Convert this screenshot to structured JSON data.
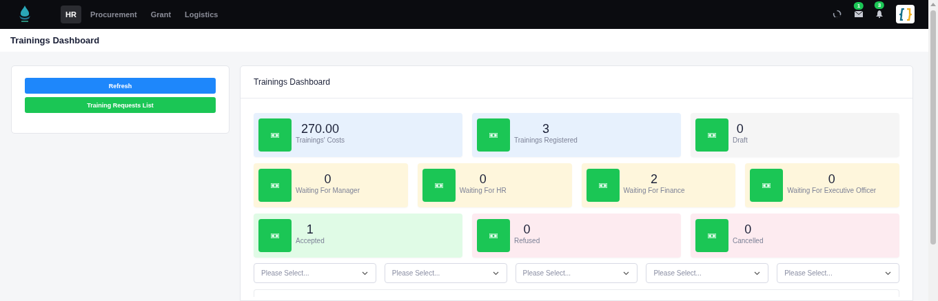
{
  "nav": {
    "tabs": [
      {
        "label": "HR",
        "selected": true
      },
      {
        "label": "Procurement",
        "selected": false
      },
      {
        "label": "Grant",
        "selected": false
      },
      {
        "label": "Logistics",
        "selected": false
      }
    ],
    "mail_badge": "1",
    "notification_badge": "3"
  },
  "page_title": "Trainings Dashboard",
  "side_panel": {
    "buttons": [
      {
        "label": "Refresh",
        "kind": "primary"
      },
      {
        "label": "Training Requests List",
        "kind": "success"
      }
    ]
  },
  "dashboard": {
    "title": "Trainings Dashboard",
    "stat_rows": [
      [
        {
          "value": "270.00",
          "label": "Trainings' Costs",
          "color": "#e7f1fd"
        },
        {
          "value": "3",
          "label": "Trainings Registered",
          "color": "#e7f1fd"
        },
        {
          "value": "0",
          "label": "Draft",
          "color": "#f5f5f5"
        }
      ],
      [
        {
          "value": "0",
          "label": "Waiting For Manager",
          "color": "#fef6dc"
        },
        {
          "value": "0",
          "label": "Waiting For HR",
          "color": "#fef6dc"
        },
        {
          "value": "2",
          "label": "Waiting For Finance",
          "color": "#fef6dc"
        },
        {
          "value": "0",
          "label": "Waiting For Executive Officer",
          "color": "#fef6dc"
        }
      ],
      [
        {
          "value": "1",
          "label": "Accepted",
          "color": "#e0fbe6"
        },
        {
          "value": "0",
          "label": "Refused",
          "color": "#fdebf0"
        },
        {
          "value": "0",
          "label": "Cancelled",
          "color": "#fdebf0"
        }
      ]
    ],
    "filters": [
      {
        "placeholder": "Please Select..."
      },
      {
        "placeholder": "Please Select..."
      },
      {
        "placeholder": "Please Select..."
      },
      {
        "placeholder": "Please Select..."
      },
      {
        "placeholder": "Please Select..."
      }
    ]
  }
}
